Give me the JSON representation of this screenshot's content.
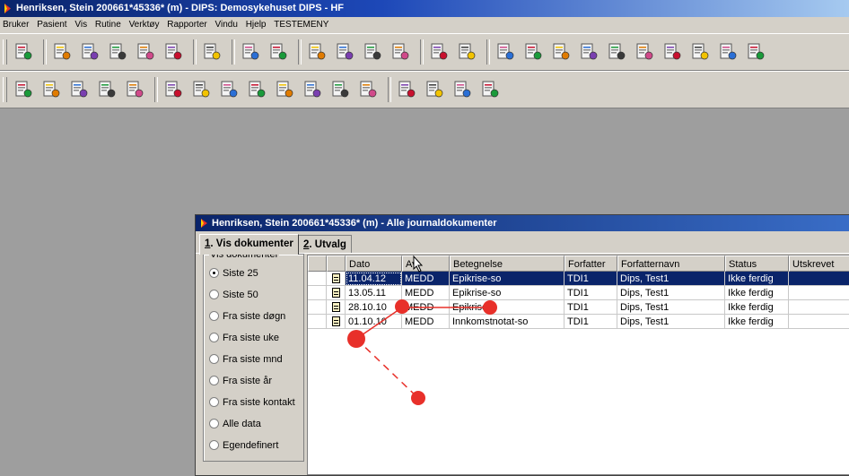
{
  "app": {
    "title": "Henriksen, Stein  200661*45336* (m) - DIPS: Demosykehuset DIPS - HF"
  },
  "menu": [
    "Bruker",
    "Pasient",
    "Vis",
    "Rutine",
    "Verktøy",
    "Rapporter",
    "Vindu",
    "Hjelp",
    "TESTEMENY"
  ],
  "toolbar1": [
    "exit-icon",
    "lock-icon",
    "patient-search-icon",
    "tree-icon",
    "blue-alarm-icon",
    "green-alarm-icon",
    "lab-icon",
    "address-book-icon",
    "form-icon",
    "folder-icon",
    "document-icon",
    "heart-icon",
    "transfer-icon",
    "list-edit-icon",
    "list-add-icon",
    "bed-icon",
    "pen-icon",
    "medication-icon",
    "report-icon",
    "calendar-icon",
    "search-doc-icon",
    "users-icon",
    "group-icon",
    "group2-icon",
    "barcode-icon"
  ],
  "toolbar2": [
    "patient-list-icon",
    "patient-add-icon",
    "patient-doc-icon",
    "patients-icon",
    "patient-edit-icon",
    "ward-icon",
    "ward-move-icon",
    "ward-add-icon",
    "ward-doc-icon",
    "ward-list-icon",
    "ward-transfer-icon",
    "folder-open-icon",
    "ward-sort-icon",
    "admit-icon",
    "admit-doc-icon",
    "admit-list-icon",
    "admit-edit-icon"
  ],
  "child": {
    "title": "Henriksen, Stein  200661*45336* (m) - Alle journaldokumenter",
    "tabs": [
      {
        "mnemonic": "1",
        "rest": ". Vis dokumenter"
      },
      {
        "mnemonic": "2",
        "rest": ". Utvalg"
      }
    ],
    "filter": {
      "legend": "Vis dokumenter",
      "options": [
        "Siste 25",
        "Siste 50",
        "Fra siste døgn",
        "Fra siste uke",
        "Fra siste mnd",
        "Fra siste år",
        "Fra siste kontakt",
        "Alle data",
        "Egendefinert"
      ],
      "selected": "Siste 25"
    },
    "grid": {
      "columns": [
        "Dato",
        "Av",
        "Betegnelse",
        "Forfatter",
        "Forfatternavn",
        "Status",
        "Utskrevet"
      ],
      "rows": [
        {
          "dato": "11.04.12",
          "av": "MEDD",
          "betegnelse": "Epikrise-so",
          "forfatter": "TDI1",
          "forfatternavn": "Dips, Test1",
          "status": "Ikke ferdig",
          "utskrevet": "",
          "selected": true
        },
        {
          "dato": "13.05.11",
          "av": "MEDD",
          "betegnelse": "Epikrise-so",
          "forfatter": "TDI1",
          "forfatternavn": "Dips, Test1",
          "status": "Ikke ferdig",
          "utskrevet": "",
          "selected": false
        },
        {
          "dato": "28.10.10",
          "av": "MEDD",
          "betegnelse": "Epikrise",
          "forfatter": "TDI1",
          "forfatternavn": "Dips, Test1",
          "status": "Ikke ferdig",
          "utskrevet": "",
          "selected": false
        },
        {
          "dato": "01.10.10",
          "av": "MEDD",
          "betegnelse": "Innkomstnotat-so",
          "forfatter": "TDI1",
          "forfatternavn": "Dips, Test1",
          "status": "Ikke ferdig",
          "utskrevet": "",
          "selected": false
        }
      ]
    }
  },
  "colors": {
    "titlebar": "#0a246a",
    "selection": "#0a246a",
    "face": "#d4d0c8",
    "desktop": "#9e9e9e",
    "annotation": "#e8302a"
  }
}
